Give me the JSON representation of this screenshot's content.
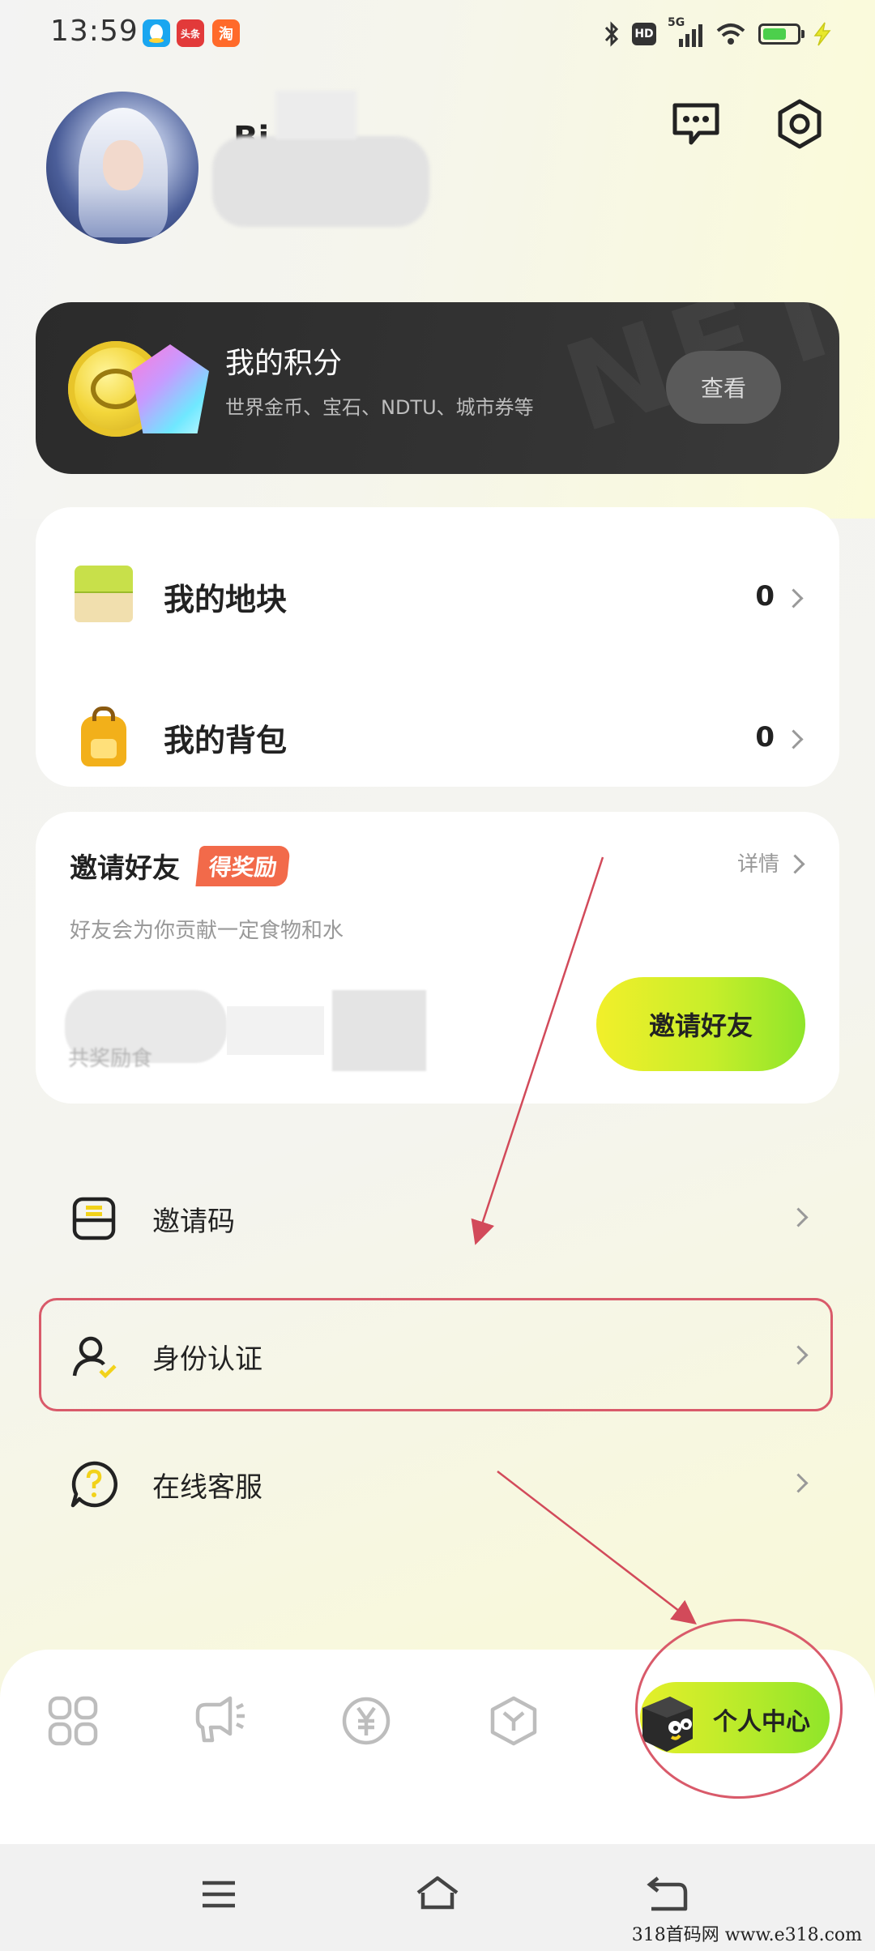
{
  "status_bar": {
    "time": "13:59",
    "apps": [
      "qq-icon",
      "toutiao-icon",
      "taobao-icon"
    ],
    "toutiao_label": "头条",
    "taobao_label": "淘",
    "hd_label": "HD",
    "net_label": "5G"
  },
  "profile": {
    "username_visible": "Bi"
  },
  "points_card": {
    "title": "我的积分",
    "subtitle": "世界金币、宝石、NDTU、城市券等",
    "view_button": "查看"
  },
  "assets": [
    {
      "label": "我的地块",
      "count": "0",
      "icon": "land-block-icon"
    },
    {
      "label": "我的背包",
      "count": "0",
      "icon": "backpack-icon"
    }
  ],
  "invite_card": {
    "title": "邀请好友",
    "reward_tag": "得奖励",
    "details": "详情",
    "subtitle": "好友会为你贡献一定食物和水",
    "blurred_stat_fragment": "共奖励食",
    "invite_button": "邀请好友"
  },
  "menu": [
    {
      "label": "邀请码",
      "icon": "invite-code-icon"
    },
    {
      "label": "身份认证",
      "icon": "identity-verify-icon"
    },
    {
      "label": "在线客服",
      "icon": "customer-service-icon"
    }
  ],
  "bottom_nav": {
    "items": [
      "home-grid-icon",
      "megaphone-icon",
      "yuan-icon",
      "cube-icon"
    ],
    "active_label": "个人中心"
  },
  "watermark": "318首码网  www.e318.com",
  "colors": {
    "accent_green": "#8fe52a",
    "accent_yellow": "#f2ef2a",
    "reward_red": "#f26a4a",
    "annotation_red": "#d95a6a"
  }
}
